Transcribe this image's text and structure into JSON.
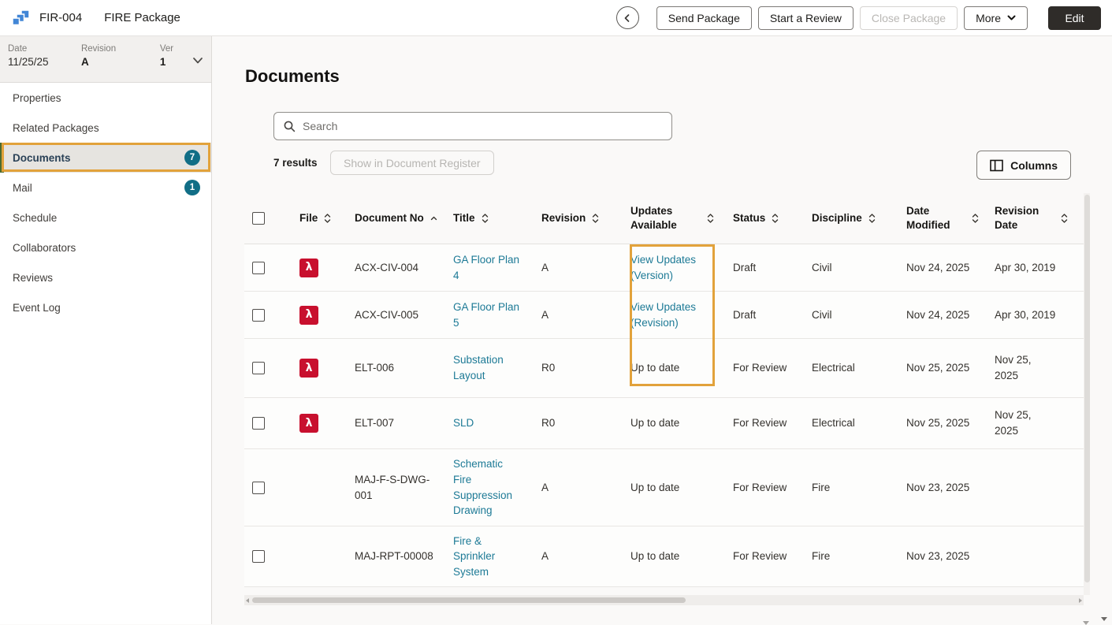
{
  "topbar": {
    "package_id": "FIR-004",
    "package_name": "FIRE Package",
    "actions": {
      "send_package": "Send Package",
      "start_review": "Start a Review",
      "close_package": "Close Package",
      "more": "More",
      "edit": "Edit"
    }
  },
  "sidebar": {
    "meta": {
      "date_label": "Date",
      "date_value": "11/25/25",
      "revision_label": "Revision",
      "revision_value": "A",
      "ver_label": "Ver",
      "ver_value": "1"
    },
    "items": [
      {
        "label": "Properties",
        "badge": ""
      },
      {
        "label": "Related Packages",
        "badge": ""
      },
      {
        "label": "Documents",
        "badge": "7"
      },
      {
        "label": "Mail",
        "badge": "1"
      },
      {
        "label": "Schedule",
        "badge": ""
      },
      {
        "label": "Collaborators",
        "badge": ""
      },
      {
        "label": "Reviews",
        "badge": ""
      },
      {
        "label": "Event Log",
        "badge": ""
      }
    ],
    "selected_item": "Documents"
  },
  "main": {
    "title": "Documents",
    "search_placeholder": "Search",
    "results_count": "7 results",
    "show_in_register_button": "Show in Document Register",
    "columns_button": "Columns",
    "table": {
      "headers": {
        "file": "File",
        "doc_no": "Document No",
        "title": "Title",
        "revision": "Revision",
        "updates": "Updates Available",
        "status": "Status",
        "discipline": "Discipline",
        "date_modified": "Date Modified",
        "revision_date": "Revision Date"
      },
      "sorted_by": "Document No",
      "sort_direction": "ascending",
      "rows": [
        {
          "file_type": "pdf",
          "doc_no": "ACX-CIV-004",
          "title": "GA Floor Plan 4",
          "revision": "A",
          "updates": "View Updates (Version)",
          "status": "Draft",
          "discipline": "Civil",
          "date_modified": "Nov 24, 2025",
          "revision_date": "Apr 30, 2019"
        },
        {
          "file_type": "pdf",
          "doc_no": "ACX-CIV-005",
          "title": "GA Floor Plan 5",
          "revision": "A",
          "updates": "View Updates (Revision)",
          "status": "Draft",
          "discipline": "Civil",
          "date_modified": "Nov 24, 2025",
          "revision_date": "Apr 30, 2019"
        },
        {
          "file_type": "pdf",
          "doc_no": "ELT-006",
          "title": "Substation Layout",
          "revision": "R0",
          "updates": "Up to date",
          "status": "For Review",
          "discipline": "Electrical",
          "date_modified": "Nov 25, 2025",
          "revision_date": "Nov 25,\n2025"
        },
        {
          "file_type": "pdf",
          "doc_no": "ELT-007",
          "title": "SLD",
          "revision": "R0",
          "updates": "Up to date",
          "status": "For Review",
          "discipline": "Electrical",
          "date_modified": "Nov 25, 2025",
          "revision_date": "Nov 25,\n2025"
        },
        {
          "file_type": "",
          "doc_no": "MAJ-F-S-DWG-001",
          "title": "Schematic Fire Suppression Drawing",
          "revision": "A",
          "updates": "Up to date",
          "status": "For Review",
          "discipline": "Fire",
          "date_modified": "Nov 23, 2025",
          "revision_date": ""
        },
        {
          "file_type": "",
          "doc_no": "MAJ-RPT-00008",
          "title": "Fire & Sprinkler System",
          "revision": "A",
          "updates": "Up to date",
          "status": "For Review",
          "discipline": "Fire",
          "date_modified": "Nov 23, 2025",
          "revision_date": ""
        }
      ]
    }
  },
  "icons": {
    "pdf_glyph": "λ"
  },
  "colors": {
    "link_teal": "#1d7a96",
    "badge_teal": "#116e86",
    "pdf_red": "#c8102e",
    "annotation_orange": "#e2a23b",
    "selected_nav_green": "#4c6b2f",
    "edit_button_bg": "#2f2c29",
    "logo_blue": "#4286d6"
  }
}
